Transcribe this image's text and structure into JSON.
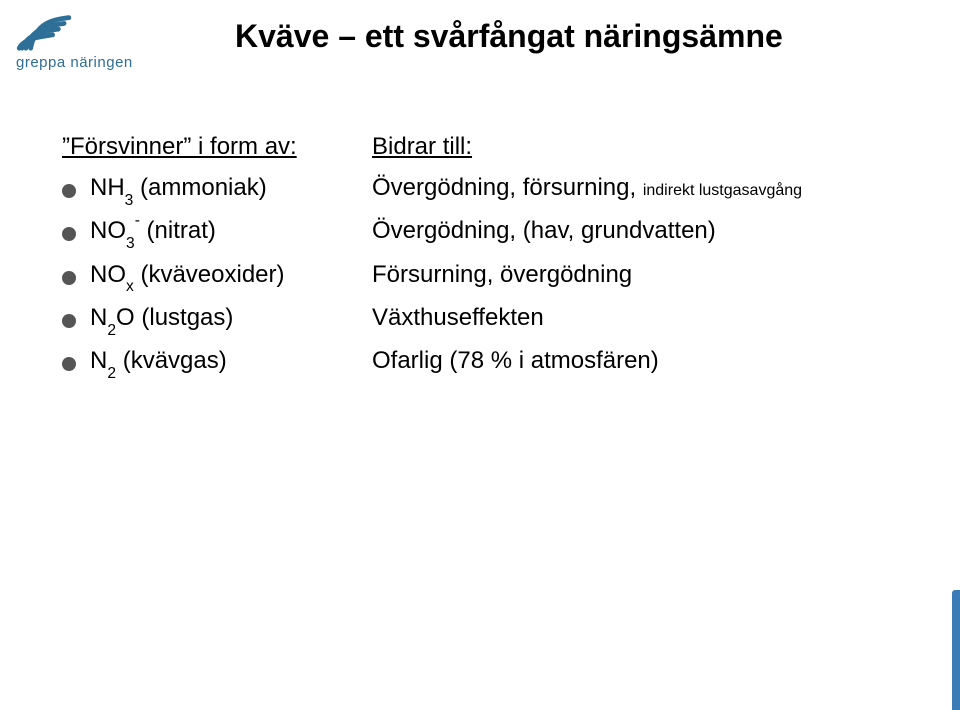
{
  "logo": {
    "text": "greppa näringen"
  },
  "title": "Kväve – ett svårfångat näringsämne",
  "leftHeading": "”Försvinner” i form av:",
  "rightHeading": "Bidrar till:",
  "items": [
    {
      "left": {
        "before": "NH",
        "sub": "3",
        "after": " (ammoniak)"
      },
      "right": {
        "main": "Övergödning, försurning, ",
        "small": "indirekt lustgasavgång"
      }
    },
    {
      "left": {
        "before": "NO",
        "sub": "3",
        "sup": "-",
        "after": " (nitrat)"
      },
      "right": {
        "main": "Övergödning, (hav, grundvatten)"
      }
    },
    {
      "left": {
        "before": "NO",
        "sub": "x",
        "after": " (kväveoxider)"
      },
      "right": {
        "main": "Försurning, övergödning"
      }
    },
    {
      "left": {
        "before": "N",
        "sub": "2",
        "after": "O (lustgas)"
      },
      "right": {
        "main": "Växthuseffekten"
      }
    },
    {
      "left": {
        "before": "N",
        "sub": "2",
        "after": " (kvävgas)"
      },
      "right": {
        "main": "Ofarlig (78 % i atmosfären)"
      }
    }
  ]
}
